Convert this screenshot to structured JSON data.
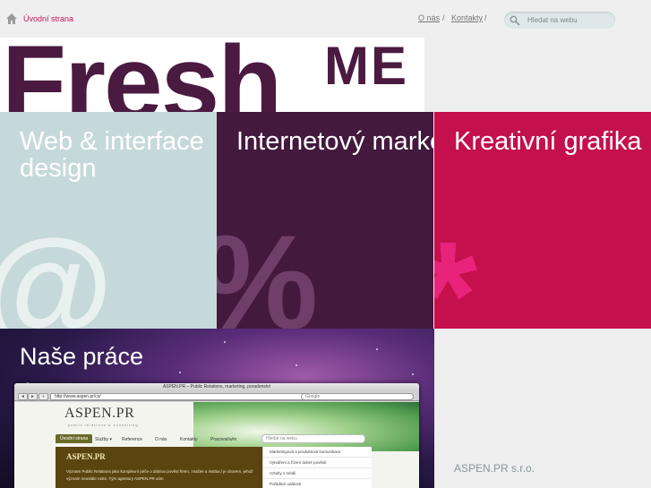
{
  "header": {
    "home_label": "Úvodní strana",
    "nav": [
      {
        "label": "O nás"
      },
      {
        "label": "Kontakty"
      }
    ],
    "separator": "/",
    "search": {
      "placeholder": "Hledat na webu"
    }
  },
  "logo": {
    "main": "Fresh",
    "sup": "ME"
  },
  "services": [
    {
      "title": "Web & interface design",
      "symbol": "@"
    },
    {
      "title": "Internetový marketing",
      "symbol": "%"
    },
    {
      "title": "Kreativní grafika",
      "symbol": "*"
    }
  ],
  "works": {
    "title": "Naše práce",
    "browser": {
      "window_title": "ASPEN.PR – Public Relations, marketing, poradenství",
      "url": "http://www.aspen.pr/cs/",
      "search_placeholder": "Google",
      "back": "◄",
      "forward": "►",
      "add": "+",
      "reload": "↻"
    },
    "site": {
      "logo": "ASPEN.PR",
      "tagline": "public relations & consulting",
      "nav": [
        "Úvodní strana",
        "Služby ▾",
        "Reference",
        "O nás",
        "Kontakty",
        "Pracoval/a/m"
      ],
      "search_placeholder": "Hledat na webu",
      "sidebar_title": "ASPEN.PR",
      "sidebar_text": "Význam Public Relations jako komplexní péče o dobrou pověst firem, značek a institucí je oborem, jehož význam neustále roste. Tým agentury ASPEN.PR vám",
      "menu": [
        "Marketingová a produktová komunikace",
        "Vytváření a řízení dobré pověsti",
        "Vztahy s médii",
        "Pořádání událostí"
      ]
    }
  },
  "sidebar": {
    "company": "ASPEN.PR s.r.o."
  },
  "colors": {
    "accent": "#c2185b",
    "panel_web": "#c6d9da",
    "panel_marketing": "#44193e",
    "panel_graphics": "#c4104d",
    "logo": "#4a1a40"
  }
}
